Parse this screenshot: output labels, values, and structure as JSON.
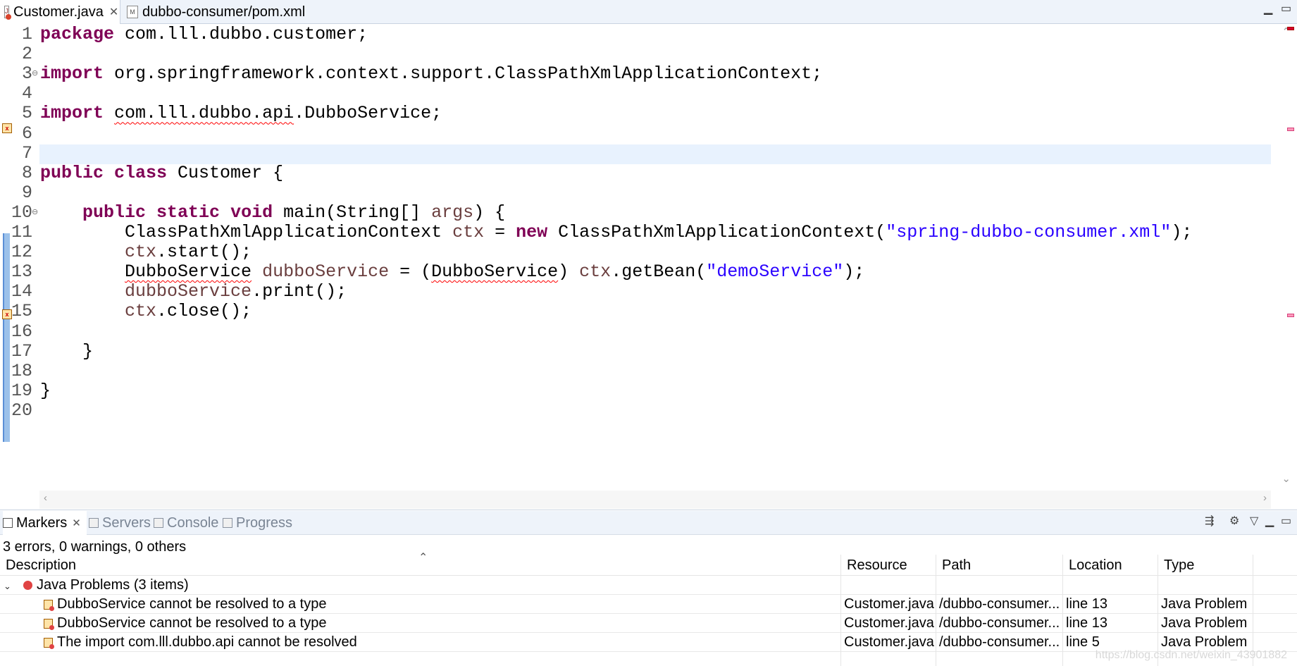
{
  "editor_tabs": [
    {
      "label": "Customer.java",
      "icon": "java-error-file-icon",
      "active": true
    },
    {
      "label": "dubbo-consumer/pom.xml",
      "icon": "maven-xml-file-icon",
      "active": false
    }
  ],
  "editor": {
    "lines": [
      {
        "n": "1",
        "code": [
          {
            "t": "package",
            "c": "kw"
          },
          {
            "t": " com.lll.dubbo.customer;"
          }
        ]
      },
      {
        "n": "2",
        "code": []
      },
      {
        "n": "3",
        "fold": "⊖",
        "code": [
          {
            "t": "import",
            "c": "kw"
          },
          {
            "t": " org.springframework.context.support.ClassPathXmlApplicationContext;"
          }
        ]
      },
      {
        "n": "4",
        "code": []
      },
      {
        "n": "5",
        "code": [
          {
            "t": "import",
            "c": "kw"
          },
          {
            "t": " "
          },
          {
            "t": "com.lll.dubbo.api",
            "c": "err"
          },
          {
            "t": ".DubboService;"
          }
        ]
      },
      {
        "n": "6",
        "code": []
      },
      {
        "n": "7",
        "code": []
      },
      {
        "n": "8",
        "code": [
          {
            "t": "public",
            "c": "kw"
          },
          {
            "t": " "
          },
          {
            "t": "class",
            "c": "kw"
          },
          {
            "t": " Customer {"
          }
        ]
      },
      {
        "n": "9",
        "code": []
      },
      {
        "n": "10",
        "fold": "⊖",
        "code": [
          {
            "t": "    "
          },
          {
            "t": "public",
            "c": "kw"
          },
          {
            "t": " "
          },
          {
            "t": "static",
            "c": "kw"
          },
          {
            "t": " "
          },
          {
            "t": "void",
            "c": "kw"
          },
          {
            "t": " main(String[] "
          },
          {
            "t": "args",
            "c": "var"
          },
          {
            "t": ") {"
          }
        ]
      },
      {
        "n": "11",
        "code": [
          {
            "t": "        ClassPathXmlApplicationContext "
          },
          {
            "t": "ctx",
            "c": "var"
          },
          {
            "t": " = "
          },
          {
            "t": "new",
            "c": "kw"
          },
          {
            "t": " ClassPathXmlApplicationContext("
          },
          {
            "t": "\"spring-dubbo-consumer.xml\"",
            "c": "str"
          },
          {
            "t": ");"
          }
        ]
      },
      {
        "n": "12",
        "code": [
          {
            "t": "        "
          },
          {
            "t": "ctx",
            "c": "var"
          },
          {
            "t": ".start();"
          }
        ]
      },
      {
        "n": "13",
        "code": [
          {
            "t": "        "
          },
          {
            "t": "DubboService",
            "c": "err"
          },
          {
            "t": " "
          },
          {
            "t": "dubboService",
            "c": "var"
          },
          {
            "t": " = ("
          },
          {
            "t": "DubboService",
            "c": "err"
          },
          {
            "t": ") "
          },
          {
            "t": "ctx",
            "c": "var"
          },
          {
            "t": ".getBean("
          },
          {
            "t": "\"demoService\"",
            "c": "str"
          },
          {
            "t": ");"
          }
        ]
      },
      {
        "n": "14",
        "code": [
          {
            "t": "        "
          },
          {
            "t": "dubboService",
            "c": "var"
          },
          {
            "t": ".print();"
          }
        ]
      },
      {
        "n": "15",
        "code": [
          {
            "t": "        "
          },
          {
            "t": "ctx",
            "c": "var"
          },
          {
            "t": ".close();"
          }
        ]
      },
      {
        "n": "16",
        "code": []
      },
      {
        "n": "17",
        "code": [
          {
            "t": "    }"
          }
        ]
      },
      {
        "n": "18",
        "code": []
      },
      {
        "n": "19",
        "code": [
          {
            "t": "}"
          }
        ]
      },
      {
        "n": "20",
        "code": []
      }
    ]
  },
  "view_tabs": [
    {
      "label": "Markers",
      "active": true,
      "icon": "markers-icon"
    },
    {
      "label": "Servers",
      "active": false,
      "icon": "servers-icon"
    },
    {
      "label": "Console",
      "active": false,
      "icon": "console-icon"
    },
    {
      "label": "Progress",
      "active": false,
      "icon": "progress-icon"
    }
  ],
  "markers": {
    "summary": "3 errors, 0 warnings, 0 others",
    "columns": [
      "Description",
      "Resource",
      "Path",
      "Location",
      "Type"
    ],
    "group": {
      "label": "Java Problems (3 items)",
      "expanded": true
    },
    "rows": [
      {
        "description": "DubboService cannot be resolved to a type",
        "resource": "Customer.java",
        "path": "/dubbo-consumer...",
        "location": "line 13",
        "type": "Java Problem"
      },
      {
        "description": "DubboService cannot be resolved to a type",
        "resource": "Customer.java",
        "path": "/dubbo-consumer...",
        "location": "line 13",
        "type": "Java Problem"
      },
      {
        "description": "The import com.lll.dubbo.api cannot be resolved",
        "resource": "Customer.java",
        "path": "/dubbo-consumer...",
        "location": "line 5",
        "type": "Java Problem"
      }
    ]
  },
  "watermark": "https://blog.csdn.net/weixin_43901882",
  "colors": {
    "keyword": "#7f0055",
    "string": "#2a00ff",
    "variable": "#6a3e3e",
    "current_line": "#e8f2fe",
    "error_underline": "#ff0000"
  }
}
